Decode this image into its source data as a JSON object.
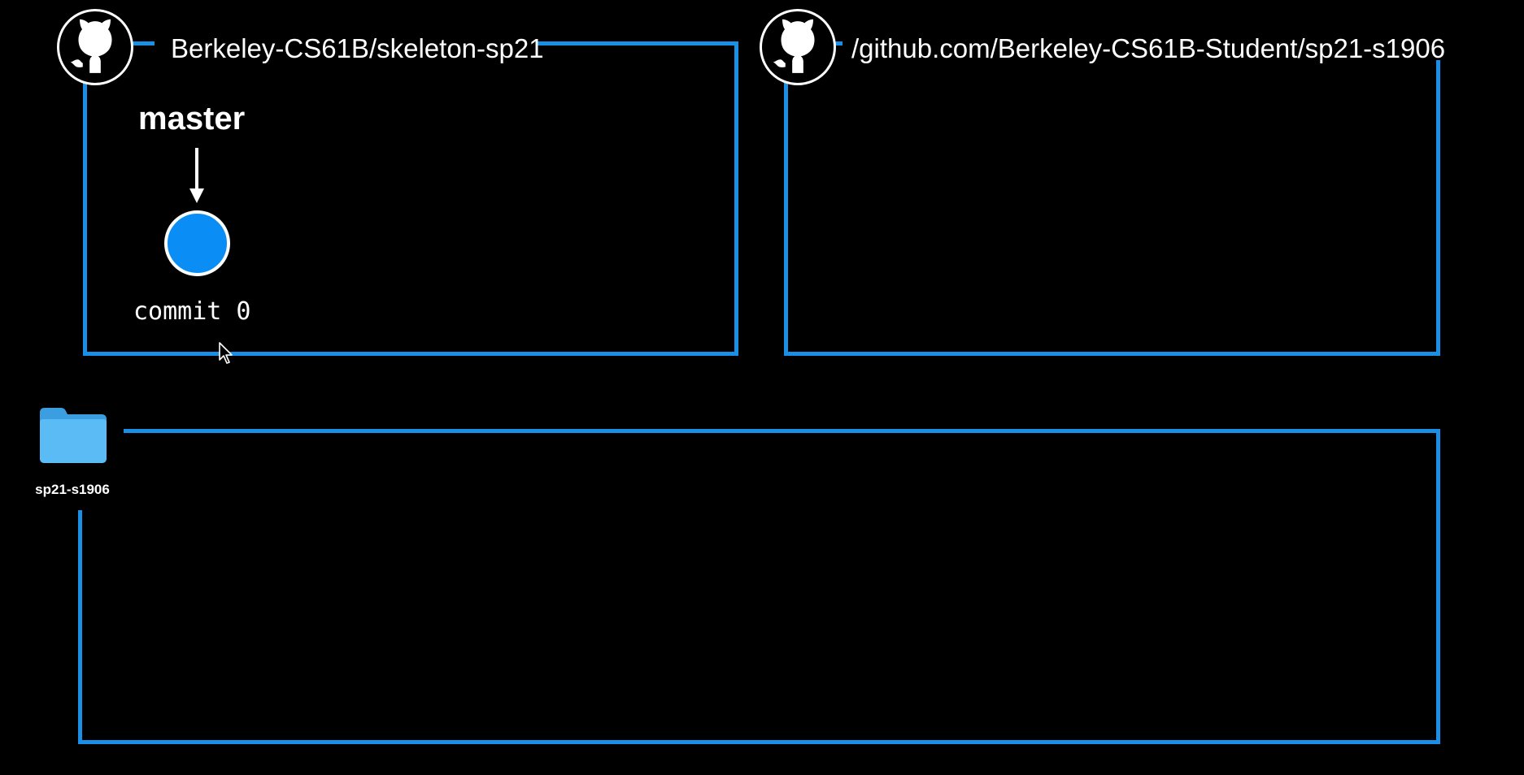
{
  "remote_skeleton": {
    "title": "Berkeley-CS61B/skeleton-sp21",
    "avatar_icon": "github-octocat-icon",
    "branch": {
      "label": "master",
      "pointer_icon": "arrow-down-icon"
    },
    "commit": {
      "label": "commit 0",
      "color": "#0a8df5"
    }
  },
  "remote_student": {
    "title": "/github.com/Berkeley-CS61B-Student/sp21-s1906",
    "avatar_icon": "github-octocat-icon"
  },
  "local_repo": {
    "folder_label": "sp21-s1906",
    "folder_icon": "folder-icon"
  },
  "colors": {
    "box_border": "#1a8fe6",
    "background": "#000000",
    "folder": "#5bbcf5"
  }
}
